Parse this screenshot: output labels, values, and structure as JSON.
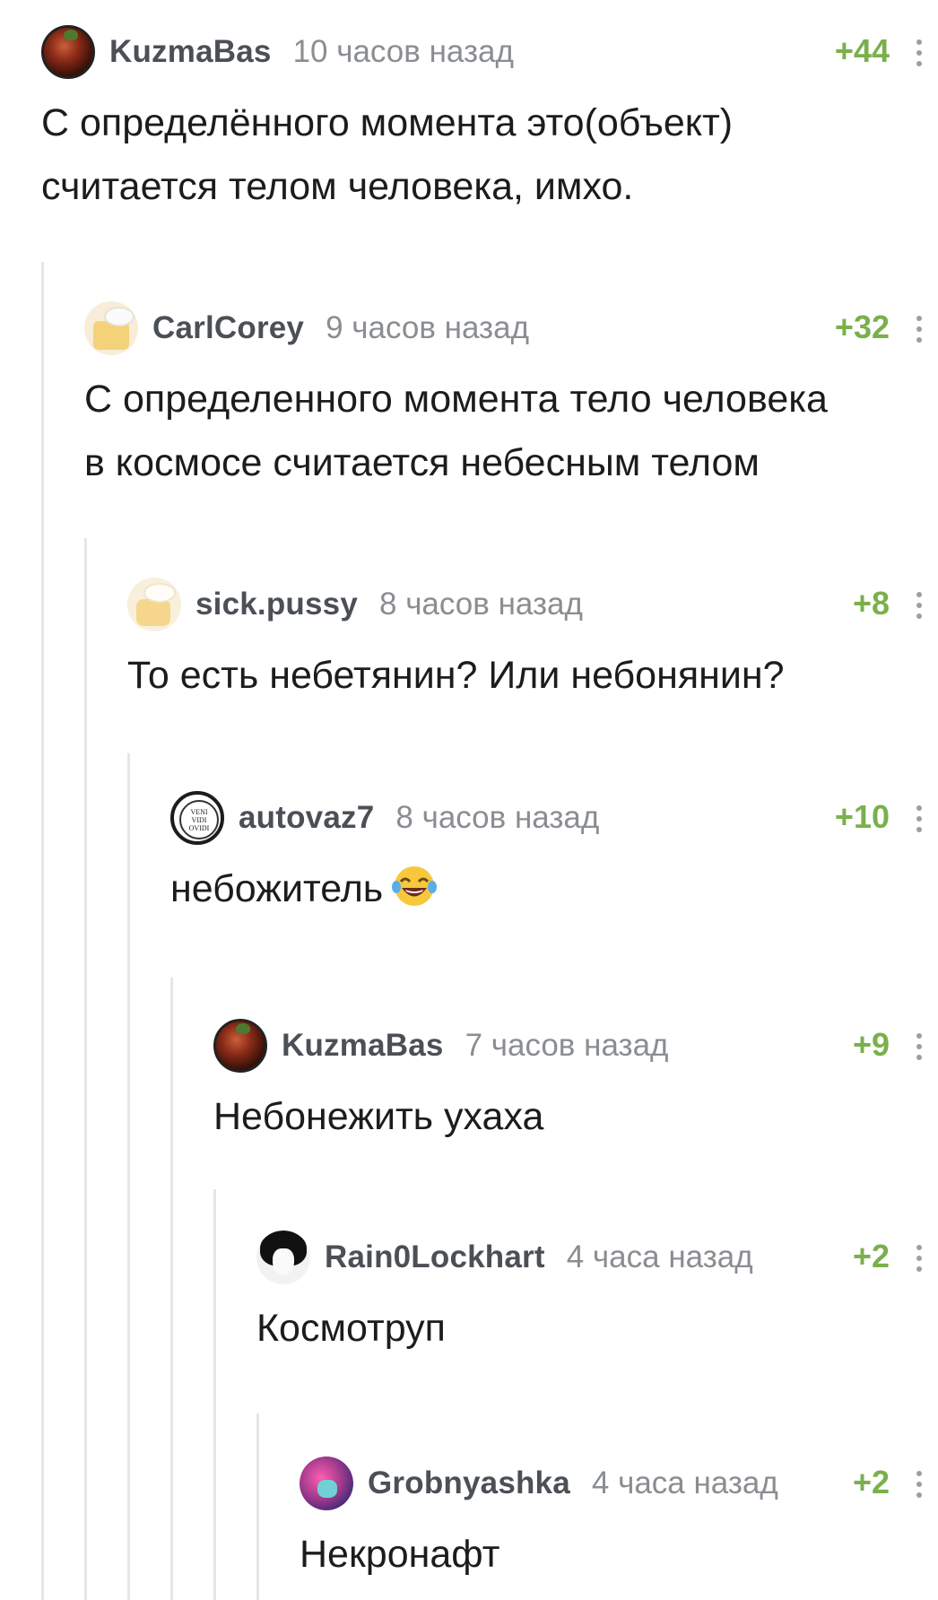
{
  "comments": [
    {
      "username": "KuzmaBas",
      "avatar_icon": "tomato-avatar-icon",
      "time": "10 часов назад",
      "rating": "+44",
      "lines": [
        "С определённого момента это(объект)",
        "считается телом человека, имхо."
      ]
    },
    {
      "username": "CarlCorey",
      "avatar_icon": "cheese-avatar-icon",
      "time": "9 часов назад",
      "rating": "+32",
      "lines": [
        "С определенного момента тело человека",
        "в космосе считается небесным телом"
      ]
    },
    {
      "username": "sick.pussy",
      "avatar_icon": "cheese-avatar-icon",
      "time": "8 часов назад",
      "rating": "+8",
      "lines": [
        "То есть небетянин? Или небонянин?"
      ]
    },
    {
      "username": "autovaz7",
      "avatar_icon": "veni-vidi-avatar-icon",
      "avatar_text": [
        "VENI",
        "VIDI",
        "OVIDI"
      ],
      "time": "8 часов назад",
      "rating": "+10",
      "lines": [
        "небожитель"
      ],
      "emoji": "laughing-crying-emoji-icon"
    },
    {
      "username": "KuzmaBas",
      "avatar_icon": "tomato-avatar-icon",
      "time": "7 часов назад",
      "rating": "+9",
      "lines": [
        "Небонежить ухаха"
      ]
    },
    {
      "username": "Rain0Lockhart",
      "avatar_icon": "anime-avatar-icon",
      "time": "4 часа назад",
      "rating": "+2",
      "lines": [
        "Космотруп"
      ]
    },
    {
      "username": "Grobnyashka",
      "avatar_icon": "zombie-avatar-icon",
      "time": "4 часа назад",
      "rating": "+2",
      "lines": [
        "Некронафт"
      ]
    }
  ],
  "colors": {
    "rating": "#7ab04c",
    "username": "#4b4f56",
    "timestamp": "#8a8d91",
    "branch_line": "#e6e6e6",
    "text": "#1c1c1c"
  }
}
